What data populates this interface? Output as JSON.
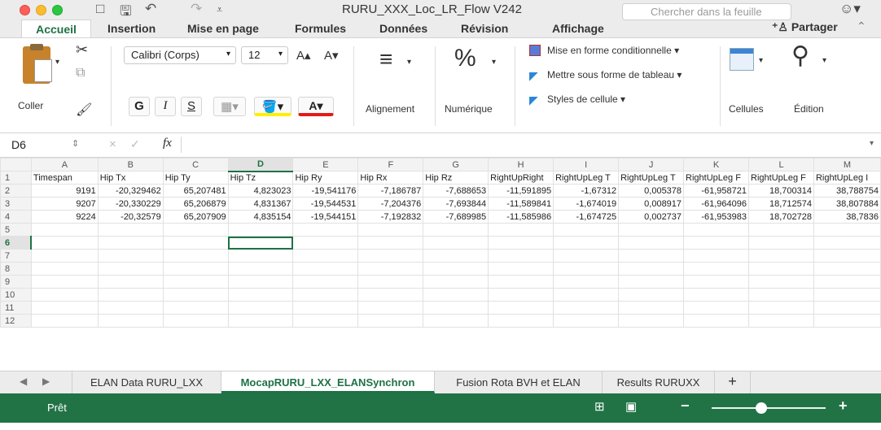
{
  "window": {
    "title": "RURU_XXX_Loc_LR_Flow V242",
    "search_placeholder": "Chercher dans la feuille"
  },
  "quick_access": {
    "sidebar_icon": "□",
    "save_icon": "🖫",
    "undo_icon": "↶",
    "redo_icon": "↷",
    "customize_icon": "⩡"
  },
  "ribbon_tabs": [
    "Accueil",
    "Insertion",
    "Mise en page",
    "Formules",
    "Données",
    "Révision",
    "Affichage"
  ],
  "share_label": "Partager",
  "ribbon": {
    "paste_label": "Coller",
    "font_name": "Calibri (Corps)",
    "font_size": "12",
    "grow_font": "A▴",
    "shrink_font": "A▾",
    "bold": "G",
    "italic": "I",
    "underline": "S",
    "font_color_letter": "A",
    "alignment_label": "Alignement",
    "number_label": "Numérique",
    "cond_format_label": "Mise en forme conditionnelle ▾",
    "table_format_label": "Mettre sous forme de tableau ▾",
    "cell_styles_label": "Styles de cellule ▾",
    "cells_label": "Cellules",
    "editing_label": "Édition"
  },
  "formula_bar": {
    "name_box": "D6",
    "fx": "fx",
    "value": ""
  },
  "grid": {
    "columns": [
      "A",
      "B",
      "C",
      "D",
      "E",
      "F",
      "G",
      "H",
      "I",
      "J",
      "K",
      "L",
      "M"
    ],
    "selected_col": "D",
    "selected_row": "6",
    "rows": [
      {
        "n": "1",
        "cells": [
          "Timespan",
          "Hip Tx",
          "Hip Ty",
          "Hip Tz",
          "Hip Ry",
          "Hip Rx",
          "Hip Rz",
          "RightUpRight",
          "RightUpLeg T",
          "RightUpLeg T",
          "RightUpLeg F",
          "RightUpLeg F",
          "RightUpLeg I"
        ]
      },
      {
        "n": "2",
        "cells": [
          "9191",
          "-20,329462",
          "65,207481",
          "4,823023",
          "-19,541176",
          "-7,186787",
          "-7,688653",
          "-11,591895",
          "-1,67312",
          "0,005378",
          "-61,958721",
          "18,700314",
          "38,788754"
        ]
      },
      {
        "n": "3",
        "cells": [
          "9207",
          "-20,330229",
          "65,206879",
          "4,831367",
          "-19,544531",
          "-7,204376",
          "-7,693844",
          "-11,589841",
          "-1,674019",
          "0,008917",
          "-61,964096",
          "18,712574",
          "38,807884"
        ]
      },
      {
        "n": "4",
        "cells": [
          "9224",
          "-20,32579",
          "65,207909",
          "4,835154",
          "-19,544151",
          "-7,192832",
          "-7,689985",
          "-11,585986",
          "-1,674725",
          "0,002737",
          "-61,953983",
          "18,702728",
          "38,7836"
        ]
      },
      {
        "n": "5",
        "cells": [
          "",
          "",
          "",
          "",
          "",
          "",
          "",
          "",
          "",
          "",
          "",
          "",
          ""
        ]
      },
      {
        "n": "6",
        "cells": [
          "",
          "",
          "",
          "",
          "",
          "",
          "",
          "",
          "",
          "",
          "",
          "",
          ""
        ]
      },
      {
        "n": "7",
        "cells": [
          "",
          "",
          "",
          "",
          "",
          "",
          "",
          "",
          "",
          "",
          "",
          "",
          ""
        ]
      },
      {
        "n": "8",
        "cells": [
          "",
          "",
          "",
          "",
          "",
          "",
          "",
          "",
          "",
          "",
          "",
          "",
          ""
        ]
      },
      {
        "n": "9",
        "cells": [
          "",
          "",
          "",
          "",
          "",
          "",
          "",
          "",
          "",
          "",
          "",
          "",
          ""
        ]
      },
      {
        "n": "10",
        "cells": [
          "",
          "",
          "",
          "",
          "",
          "",
          "",
          "",
          "",
          "",
          "",
          "",
          ""
        ]
      },
      {
        "n": "11",
        "cells": [
          "",
          "",
          "",
          "",
          "",
          "",
          "",
          "",
          "",
          "",
          "",
          "",
          ""
        ]
      },
      {
        "n": "12",
        "cells": [
          "",
          "",
          "",
          "",
          "",
          "",
          "",
          "",
          "",
          "",
          "",
          "",
          ""
        ]
      }
    ]
  },
  "sheet_tabs": [
    "ELAN Data RURU_LXX",
    "MocapRURU_LXX_ELANSynchron",
    "Fusion Rota BVH et ELAN",
    "Results RURUXX"
  ],
  "active_sheet_index": 1,
  "add_sheet": "+",
  "status": {
    "ready": "Prêt",
    "zoom_minus": "−",
    "zoom_plus": "+"
  },
  "colors": {
    "accent": "#217346",
    "selection": "#1e7145"
  }
}
